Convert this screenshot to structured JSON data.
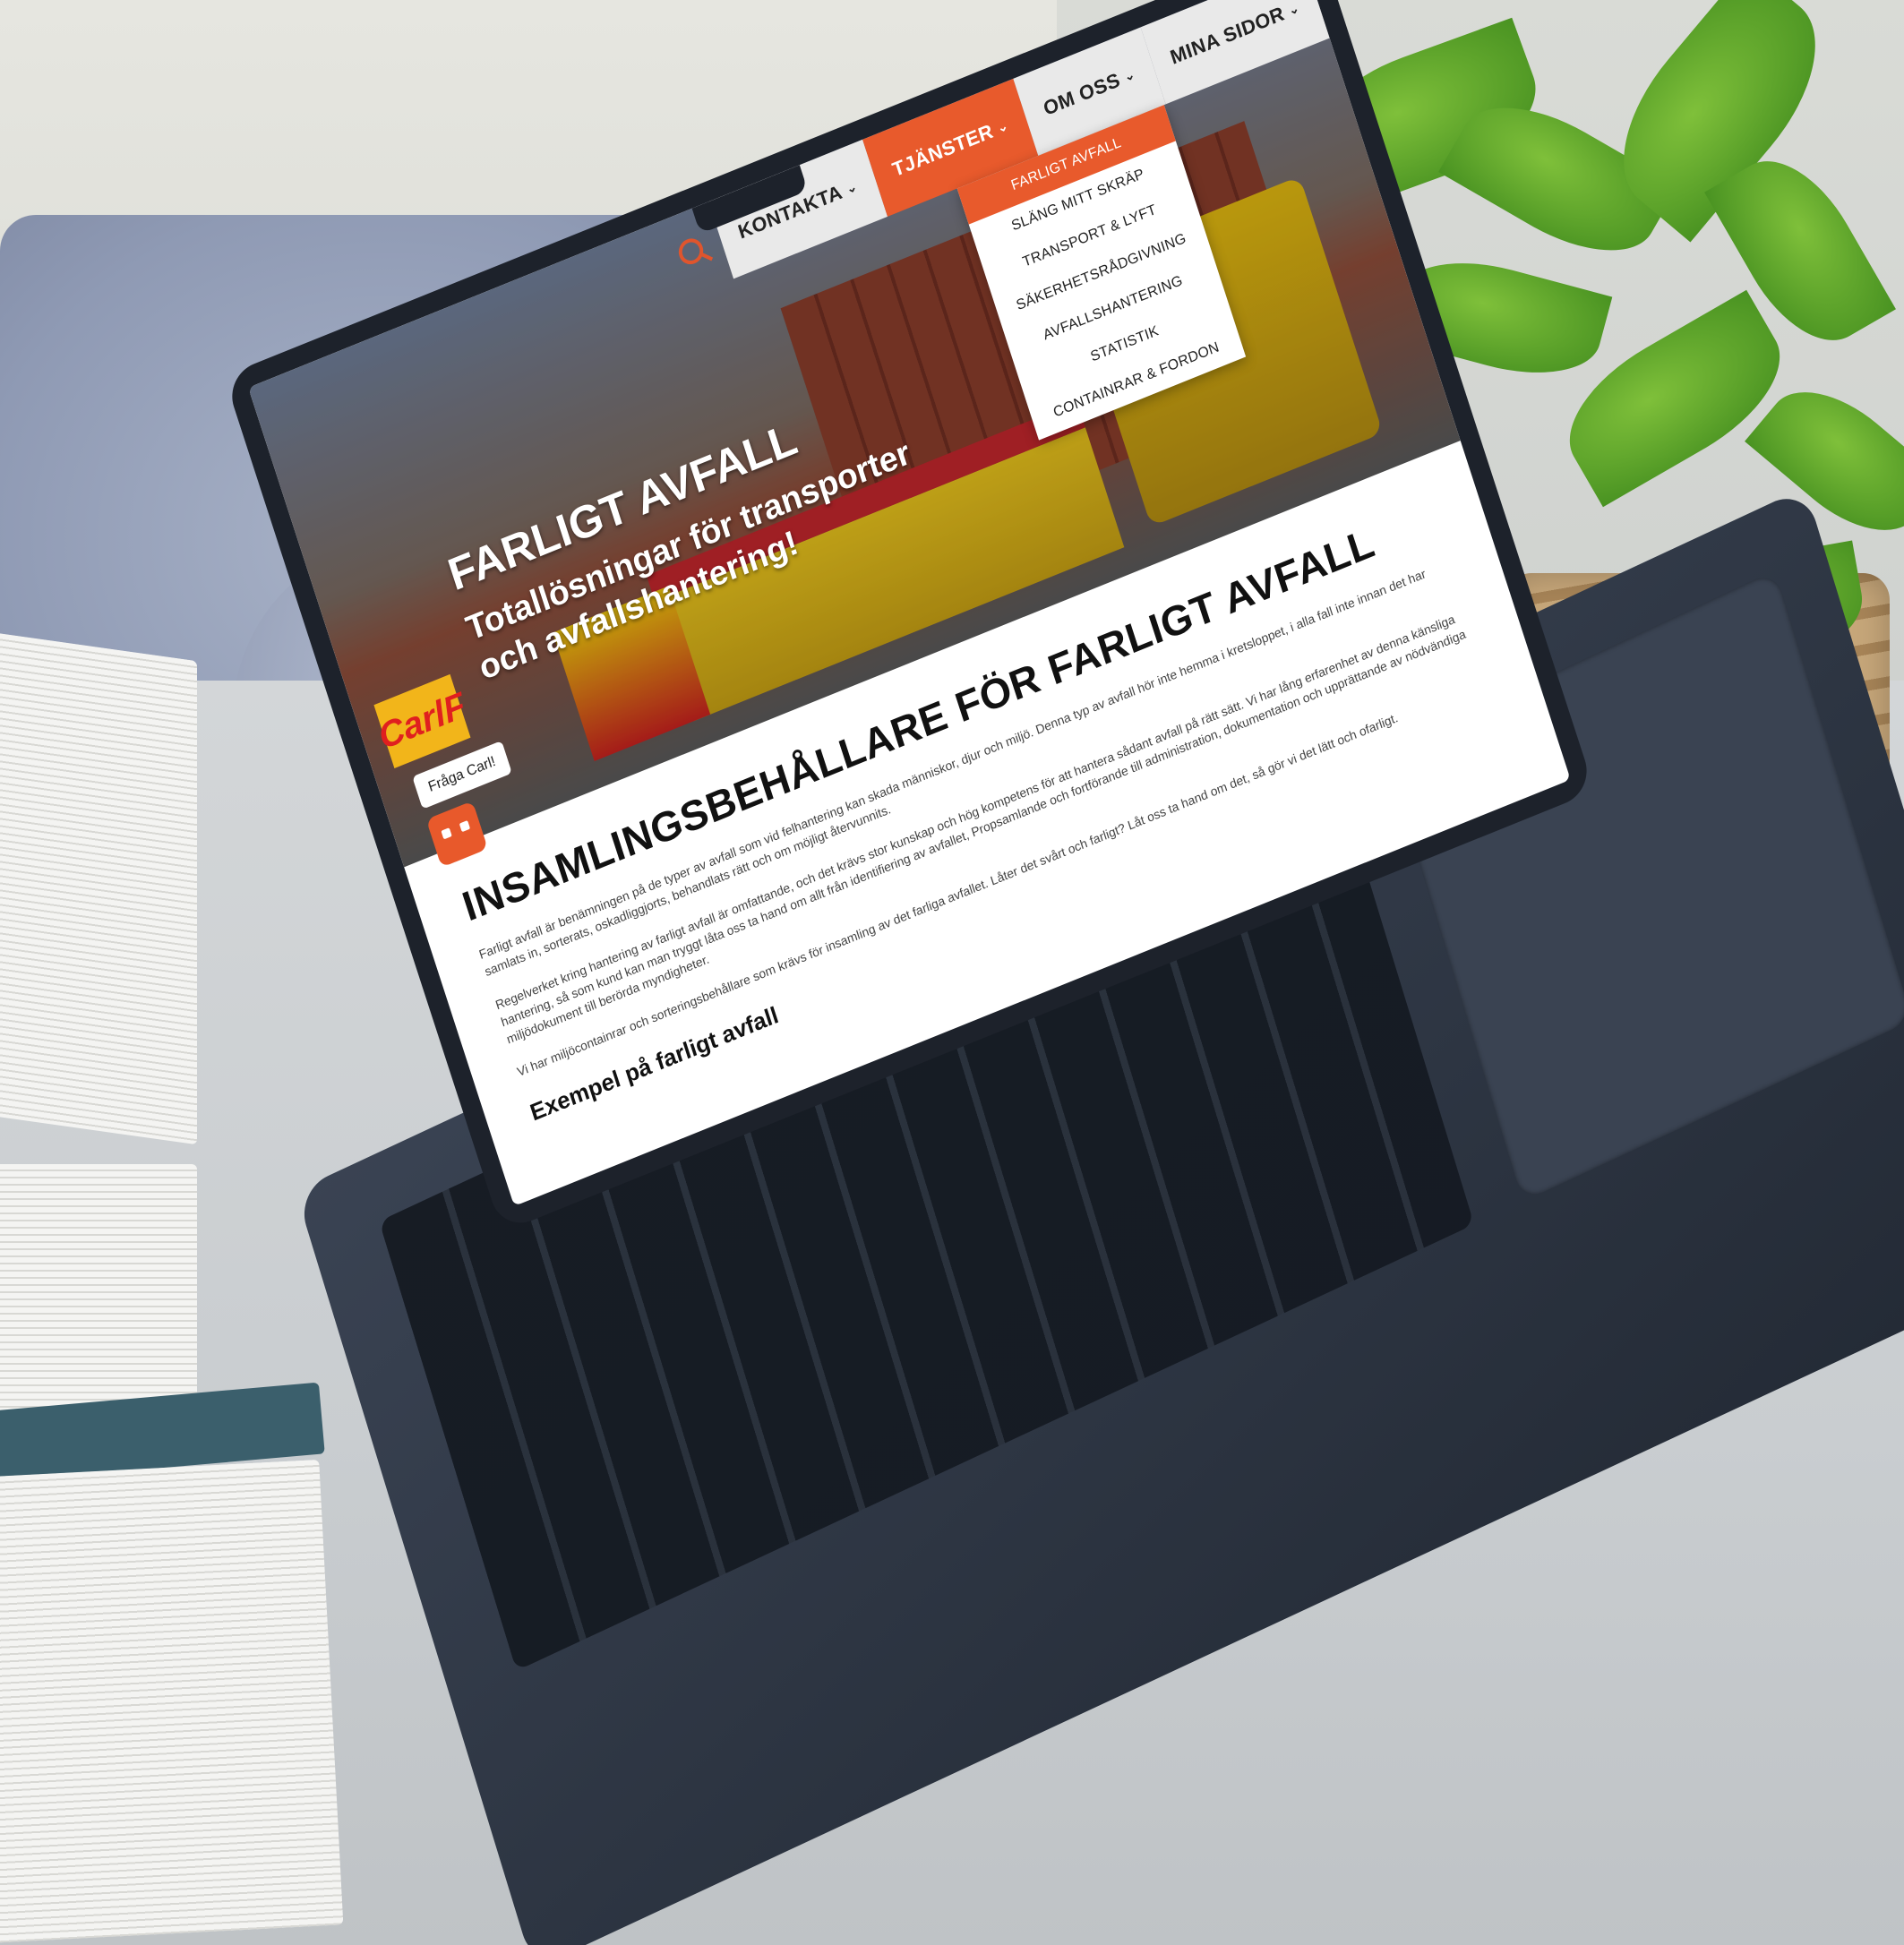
{
  "site": {
    "logo_text": "CarlF",
    "nav": [
      {
        "label": "KONTAKTA",
        "active": false
      },
      {
        "label": "TJÄNSTER",
        "active": true
      },
      {
        "label": "OM OSS",
        "active": false
      },
      {
        "label": "MINA SIDOR",
        "active": false
      }
    ],
    "dropdown": [
      "FARLIGT AVFALL",
      "SLÄNG MITT SKRÄP",
      "TRANSPORT & LYFT",
      "SÄKERHETSRÅDGIVNING",
      "AVFALLSHANTERING",
      "STATISTIK",
      "CONTAINRAR & FORDON"
    ],
    "hero": {
      "title": "FARLIGT AVFALL",
      "subtitle": "Totallösningar för transporter och avfallshantering!"
    },
    "chat": {
      "label": "Fråga Carl!"
    },
    "content": {
      "heading": "INSAMLINGSBEHÅLLARE FÖR FARLIGT AVFALL",
      "paragraph1": "Farligt avfall är benämningen på de typer av avfall som vid felhantering kan skada människor, djur och miljö. Denna typ av avfall hör inte hemma i kretsloppet, i alla fall inte innan det har samlats in, sorterats, oskadliggjorts, behandlats rätt och om möjligt återvunnits.",
      "paragraph2": "Regelverket kring hantering av farligt avfall är omfattande, och det krävs stor kunskap och hög kompetens för att hantera sådant avfall på rätt sätt. Vi har lång erfarenhet av denna känsliga hantering, så som kund kan man tryggt låta oss ta hand om allt från identifiering av avfallet, Propsamlande och fortförande till administration, dokumentation och upprättande av nödvändiga miljödokument till berörda myndigheter.",
      "paragraph3": "Vi har miljöcontainrar och sorteringsbehållare som krävs för insamling av det farliga avfallet. Låter det svårt och farligt? Låt oss ta hand om det, så gör vi det lätt och ofarligt.",
      "subheading": "Exempel på farligt avfall"
    }
  },
  "colors": {
    "accent": "#e85a2c",
    "logo_bg": "#f2b51a",
    "logo_text": "#e01f1f"
  }
}
